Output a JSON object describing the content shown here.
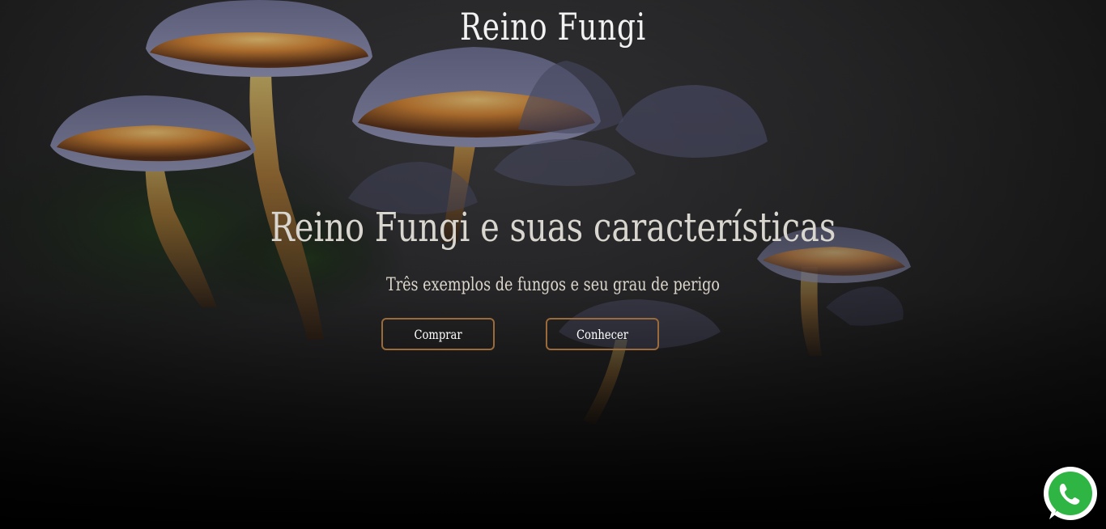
{
  "header": {
    "site_title": "Reino Fungi"
  },
  "hero": {
    "headline": "Reino Fungi e suas características",
    "subtitle": "Três exemplos de fungos e seu grau de perigo",
    "buttons": {
      "buy_label": "Comprar",
      "know_label": "Conhecer"
    }
  },
  "floating": {
    "whatsapp_icon": "whatsapp-icon"
  },
  "colors": {
    "button_border": "#9a6a3a",
    "whatsapp_green": "#2fb543",
    "background": "#1c1c1c",
    "mushroom_glow": "#f2a23a",
    "mushroom_cap": "#7d7fa8"
  }
}
